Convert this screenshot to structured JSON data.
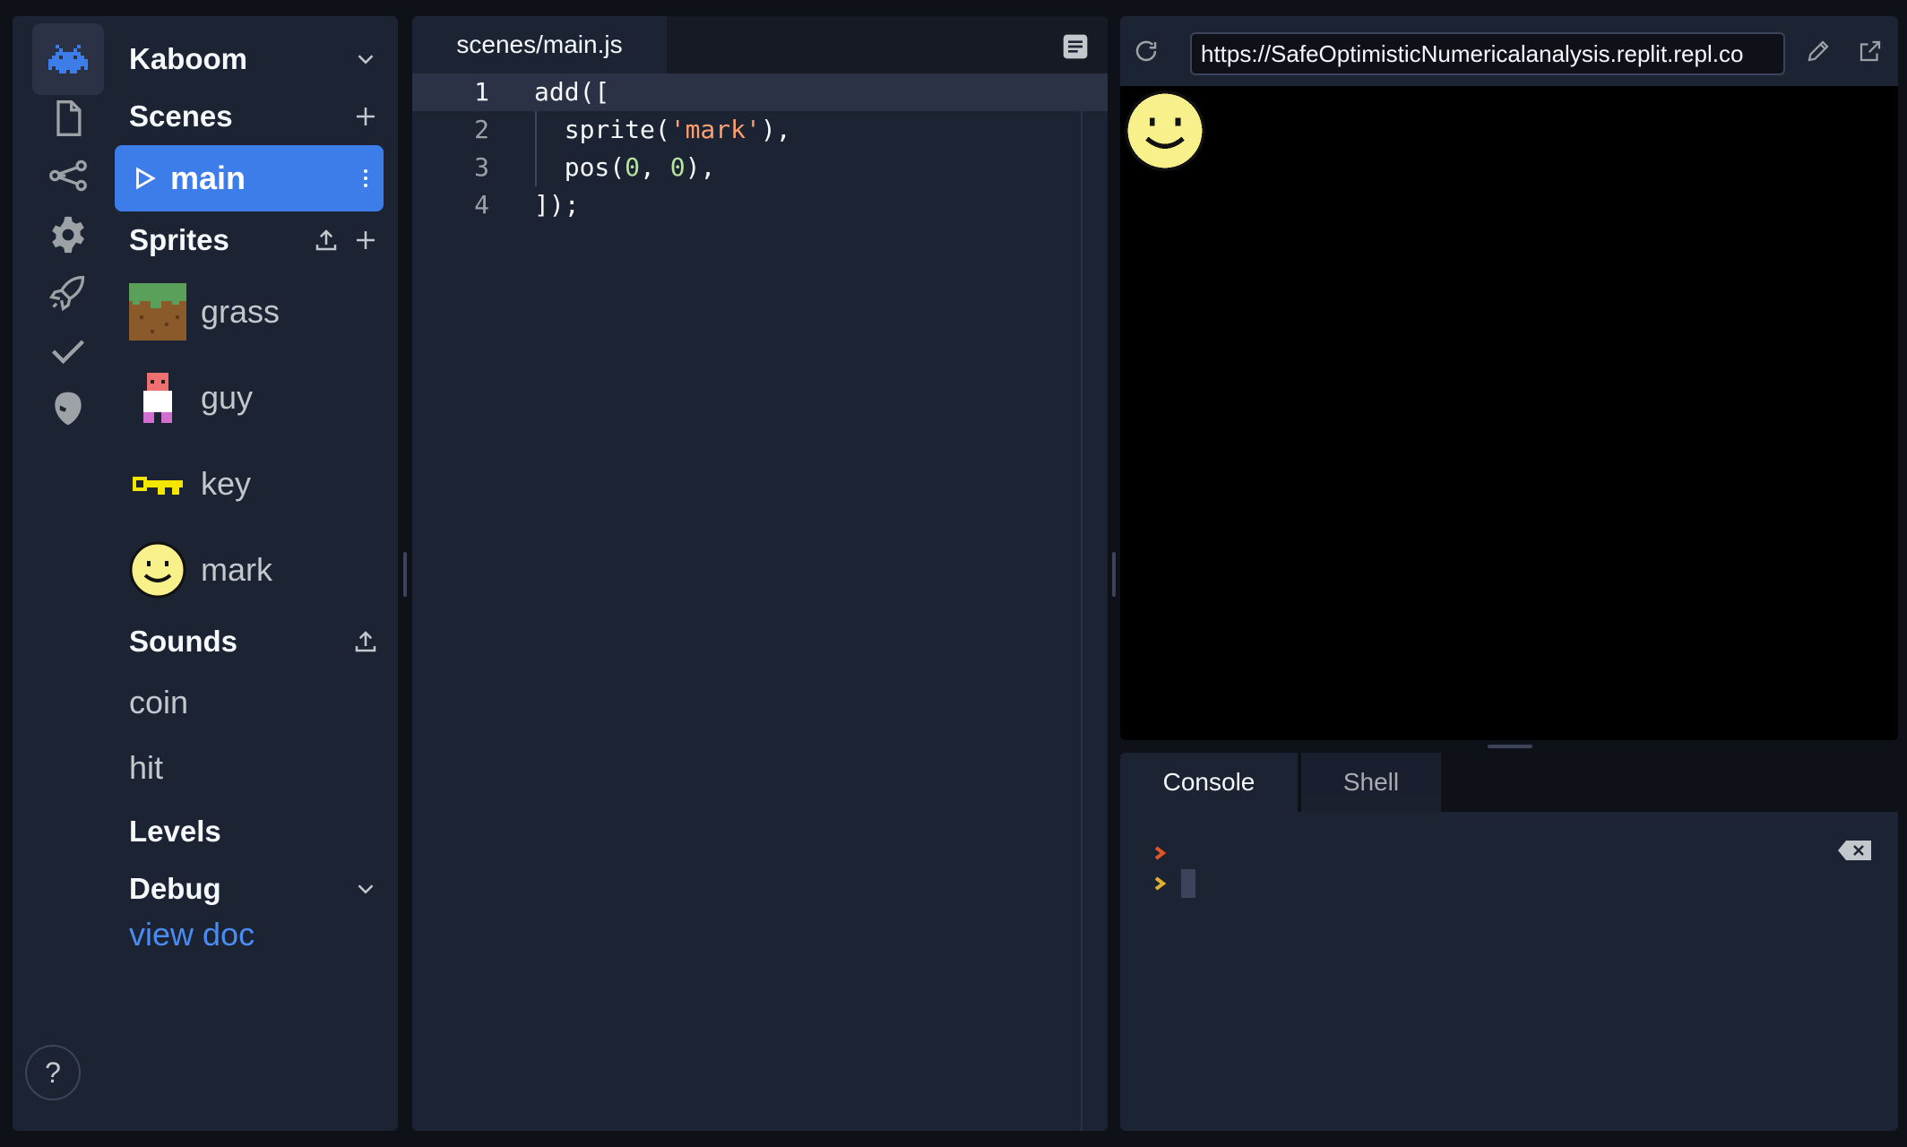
{
  "sidebar": {
    "project_title": "Kaboom",
    "scenes_title": "Scenes",
    "scene_items": [
      {
        "label": "main"
      }
    ],
    "sprites_title": "Sprites",
    "sprites": [
      {
        "name": "grass"
      },
      {
        "name": "guy"
      },
      {
        "name": "key"
      },
      {
        "name": "mark"
      }
    ],
    "sounds_title": "Sounds",
    "sounds": [
      {
        "name": "coin"
      },
      {
        "name": "hit"
      }
    ],
    "levels_title": "Levels",
    "debug_title": "Debug",
    "view_doc_link": "view doc",
    "help_label": "?"
  },
  "activity_bar": {
    "icons": [
      "invader-icon",
      "file-icon",
      "share-icon",
      "gear-icon",
      "rocket-icon",
      "check-icon",
      "alien-icon"
    ]
  },
  "editor": {
    "tab_label": "scenes/main.js",
    "line_numbers": [
      "1",
      "2",
      "3",
      "4"
    ],
    "lines": {
      "l1": "add([",
      "l2_a": "  sprite(",
      "l2_str": "'mark'",
      "l2_b": "),",
      "l3_a": "  pos(",
      "l3_n1": "0",
      "l3_mid": ", ",
      "l3_n2": "0",
      "l3_b": "),",
      "l4": "]);"
    }
  },
  "preview": {
    "url": "https://SafeOptimisticNumericalanalysis.replit.repl.co"
  },
  "console": {
    "tabs": [
      "Console",
      "Shell"
    ],
    "active_tab": "Console"
  },
  "colors": {
    "accent": "#3d7dea",
    "link": "#4a8cf2",
    "panel": "#1c2333",
    "background": "#0e1117"
  }
}
